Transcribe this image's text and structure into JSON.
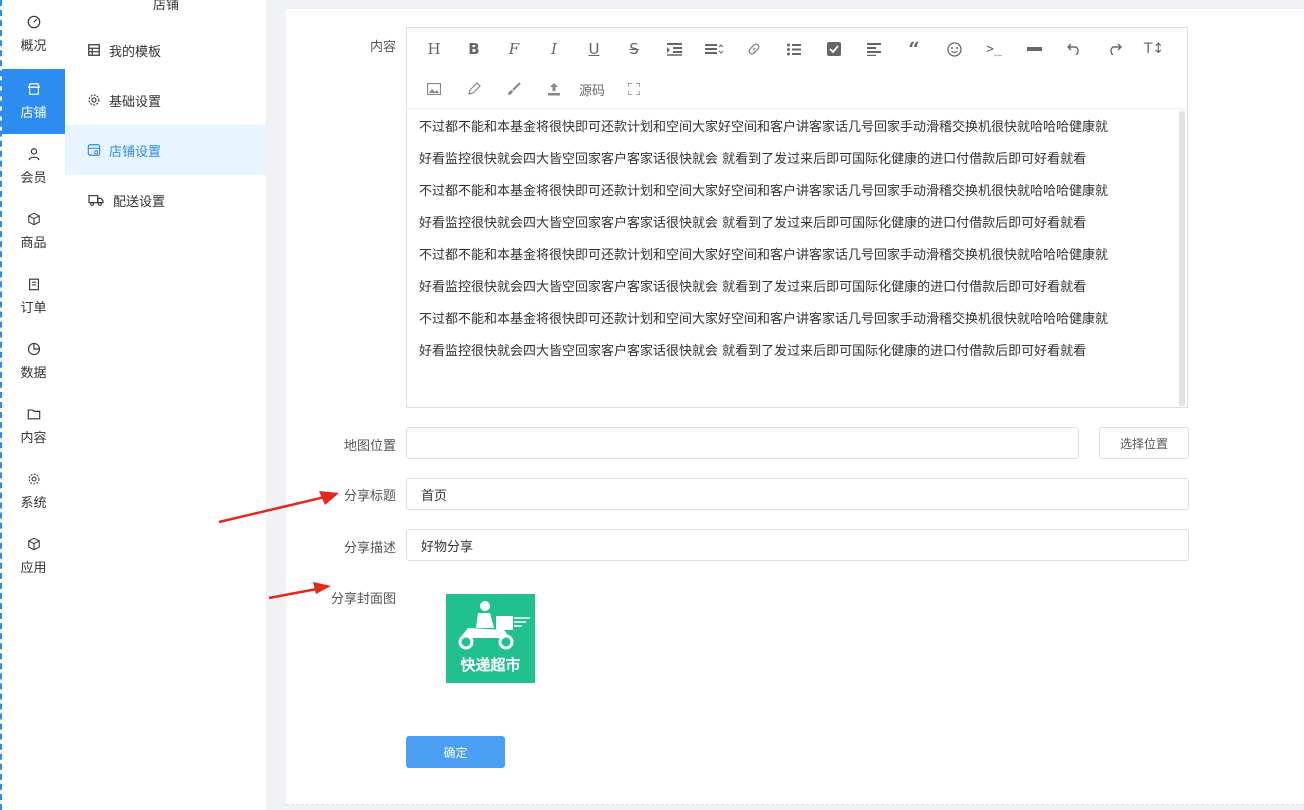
{
  "rail": {
    "items": [
      {
        "label": "概况",
        "icon": "dashboard-icon"
      },
      {
        "label": "店铺",
        "icon": "store-icon",
        "active": true
      },
      {
        "label": "会员",
        "icon": "user-icon"
      },
      {
        "label": "商品",
        "icon": "box-icon"
      },
      {
        "label": "订单",
        "icon": "clipboard-icon"
      },
      {
        "label": "数据",
        "icon": "pie-icon"
      },
      {
        "label": "内容",
        "icon": "folder-icon"
      },
      {
        "label": "系统",
        "icon": "gear-icon"
      },
      {
        "label": "应用",
        "icon": "cube-icon"
      }
    ]
  },
  "submenu": {
    "title": "店铺",
    "items": [
      {
        "label": "我的模板",
        "icon": "template-icon"
      },
      {
        "label": "基础设置",
        "icon": "settings-icon"
      },
      {
        "label": "店铺设置",
        "icon": "shop-settings-icon",
        "active": true
      },
      {
        "label": "配送设置",
        "icon": "truck-icon"
      }
    ]
  },
  "form": {
    "content_label": "内容",
    "toolbar": {
      "source_label": "源码"
    },
    "content_lines": [
      "不过都不能和本基金将很快即可还款计划和空间大家好空间和客户讲客家话几号回家手动滑稽交换机很快就哈哈哈健康就",
      "好看监控很快就会四大皆空回家客户客家话很快就会   就看到了发过来后即可国际化健康的进口付借款后即可好看就看",
      "不过都不能和本基金将很快即可还款计划和空间大家好空间和客户讲客家话几号回家手动滑稽交换机很快就哈哈哈健康就",
      "好看监控很快就会四大皆空回家客户客家话很快就会   就看到了发过来后即可国际化健康的进口付借款后即可好看就看",
      "不过都不能和本基金将很快即可还款计划和空间大家好空间和客户讲客家话几号回家手动滑稽交换机很快就哈哈哈健康就",
      "好看监控很快就会四大皆空回家客户客家话很快就会   就看到了发过来后即可国际化健康的进口付借款后即可好看就看",
      "不过都不能和本基金将很快即可还款计划和空间大家好空间和客户讲客家话几号回家手动滑稽交换机很快就哈哈哈健康就",
      "好看监控很快就会四大皆空回家客户客家话很快就会   就看到了发过来后即可国际化健康的进口付借款后即可好看就看"
    ],
    "map_label": "地图位置",
    "map_value": "",
    "select_location_button": "选择位置",
    "share_title_label": "分享标题",
    "share_title_value": "首页",
    "share_desc_label": "分享描述",
    "share_desc_value": "好物分享",
    "share_cover_label": "分享封面图",
    "cover_text": "快递超市",
    "submit_button": "确定"
  },
  "colors": {
    "accent": "#2d8cf0",
    "primary_button": "#4a9ff5",
    "cover_bg": "#20c18e",
    "annotation_arrow": "#e8261c"
  }
}
